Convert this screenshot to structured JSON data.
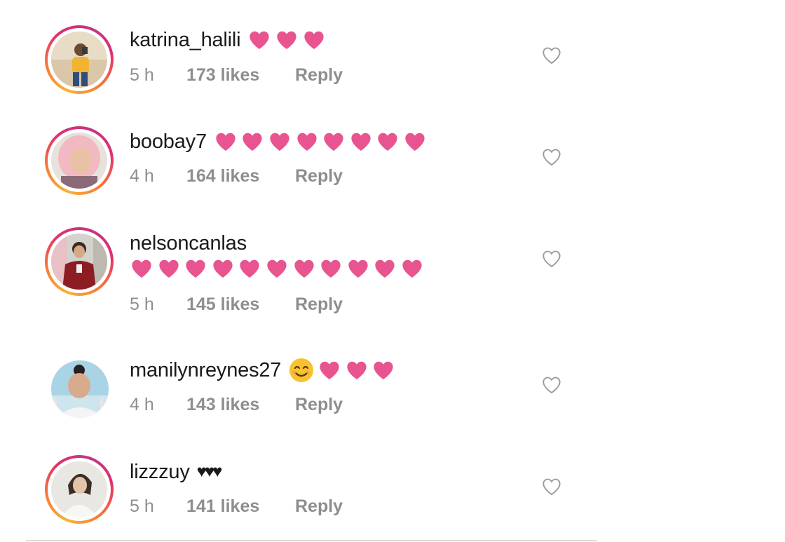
{
  "comments": [
    {
      "username": "katrina_halili",
      "pink_hearts": 3,
      "time": "5 h",
      "likes": "173 likes",
      "reply": "Reply",
      "avatar_icon": "avatar-photo",
      "has_story_ring": true
    },
    {
      "username": "boobay7",
      "pink_hearts": 8,
      "time": "4 h",
      "likes": "164 likes",
      "reply": "Reply",
      "avatar_icon": "avatar-photo",
      "has_story_ring": true
    },
    {
      "username": "nelsoncanlas",
      "pink_hearts": 11,
      "hearts_on_new_line": true,
      "time": "5 h",
      "likes": "145 likes",
      "reply": "Reply",
      "avatar_icon": "avatar-photo",
      "has_story_ring": true
    },
    {
      "username": "manilynreynes27",
      "emoji": "smiling-face-emoji",
      "pink_hearts": 3,
      "time": "4 h",
      "likes": "143 likes",
      "reply": "Reply",
      "avatar_icon": "avatar-photo",
      "has_story_ring": false
    },
    {
      "username": "lizzzuy",
      "text": "♥♥♥",
      "time": "5 h",
      "likes": "141 likes",
      "reply": "Reply",
      "avatar_icon": "avatar-photo",
      "has_story_ring": true
    }
  ],
  "colors": {
    "pink_heart": "#e8548f",
    "meta_text": "#8e8e8e",
    "username_text": "#1a1a1a",
    "like_icon_stroke": "#9a9a9a",
    "divider": "#dbdbdb"
  },
  "icons": {
    "like": "heart-outline-icon",
    "pink_heart": "pink-heart-emoji",
    "smile": "smiling-face-emoji"
  }
}
